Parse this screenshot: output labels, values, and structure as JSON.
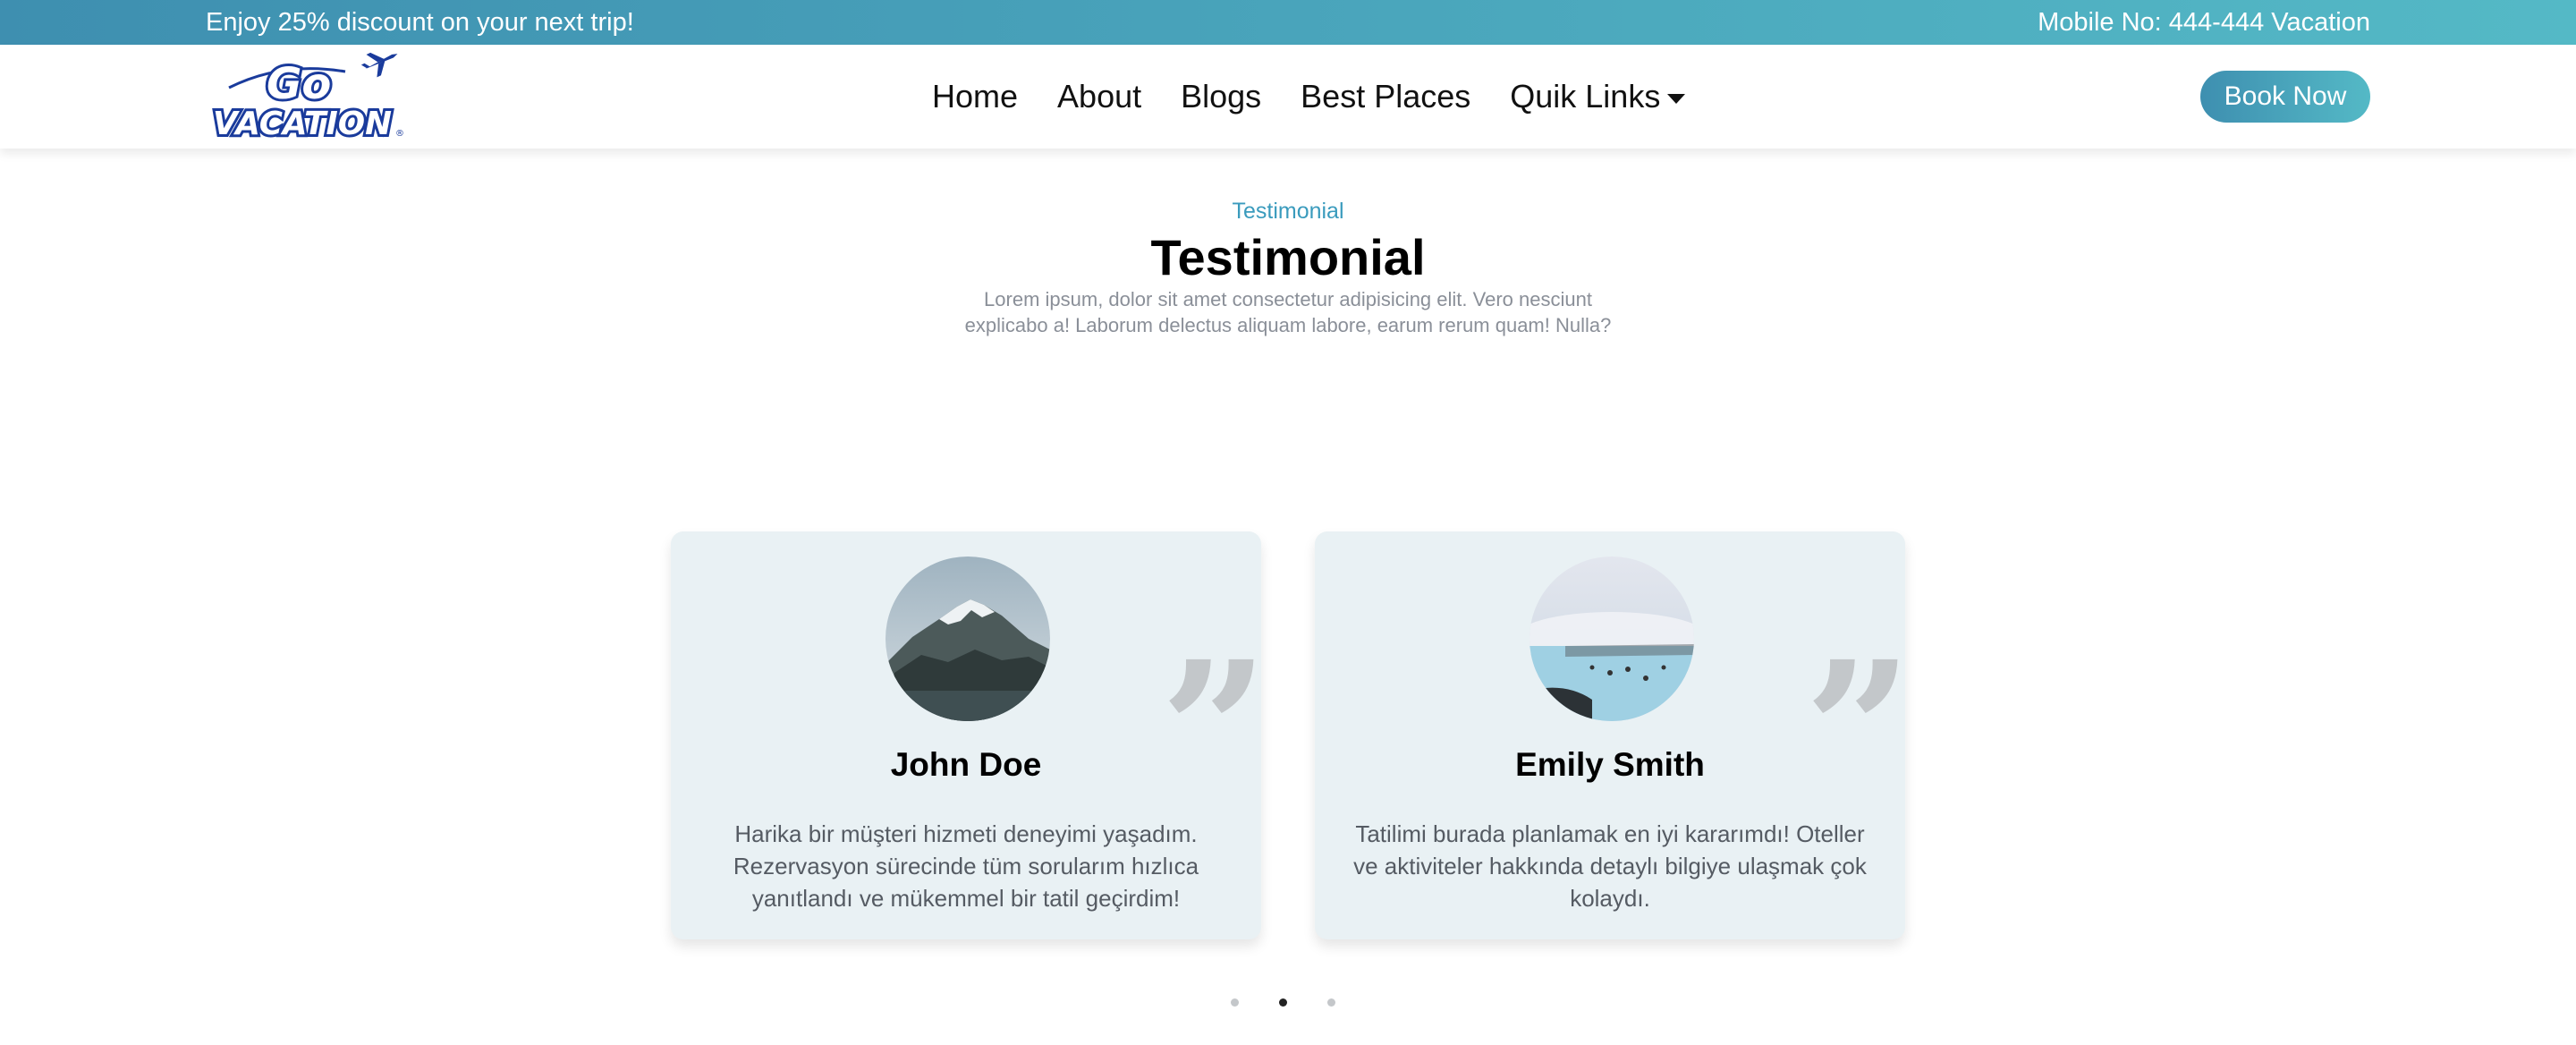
{
  "topbar": {
    "promo": "Enjoy 25% discount on your next trip!",
    "phone": "Mobile No: 444-444 Vacation"
  },
  "nav": {
    "logo": {
      "line1": "Go",
      "line2": "VACATION",
      "mark": "®"
    },
    "links": [
      "Home",
      "About",
      "Blogs",
      "Best Places",
      "Quik Links"
    ],
    "book_now": "Book Now"
  },
  "section": {
    "kicker": "Testimonial",
    "title": "Testimonial",
    "description": "Lorem ipsum, dolor sit amet consectetur adipisicing elit. Vero nesciunt explicabo a! Laborum delectus aliquam labore, earum rerum quam! Nulla?"
  },
  "testimonials": [
    {
      "name": "John Doe",
      "avatar_icon": "snowy-mountain-photo",
      "text": "Harika bir müşteri hizmeti deneyimi yaşadım. Rezervasyon sürecinde tüm sorularım hızlıca yanıtlandı ve mükemmel bir tatil geçirdim!",
      "quote_glyph": "”"
    },
    {
      "name": "Emily Smith",
      "avatar_icon": "hot-spring-lagoon-photo",
      "text": "Tatilimi burada planlamak en iyi kararımdı! Oteller ve aktiviteler hakkında detaylı bilgiye ulaşmak çok kolaydı.",
      "quote_glyph": "”"
    }
  ],
  "carousel": {
    "dot_count": 3,
    "active_index": 1
  },
  "colors": {
    "accent_start": "#3e8fb0",
    "accent_end": "#54b9c6",
    "card_bg": "#e9f1f4",
    "kicker": "#3a9bbd"
  }
}
